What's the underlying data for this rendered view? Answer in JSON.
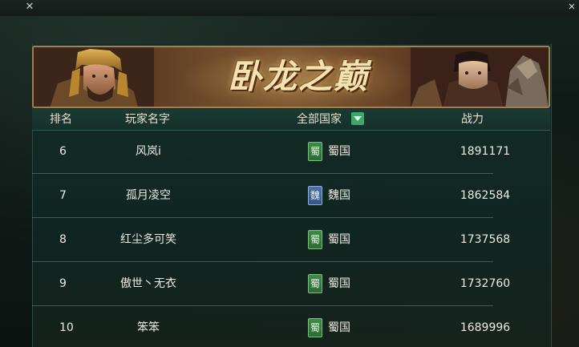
{
  "banner": {
    "title": "卧龙之巅"
  },
  "table": {
    "headers": {
      "rank": "排名",
      "name": "玩家名字",
      "country": "全部国家",
      "power": "战力"
    },
    "rows": [
      {
        "rank": "6",
        "name": "风岚i",
        "badge": "蜀",
        "badge_kind": "shu",
        "country": "蜀国",
        "power": "1891171"
      },
      {
        "rank": "7",
        "name": "孤月凌空",
        "badge": "魏",
        "badge_kind": "wei",
        "country": "魏国",
        "power": "1862584"
      },
      {
        "rank": "8",
        "name": "红尘多可笑",
        "badge": "蜀",
        "badge_kind": "shu",
        "country": "蜀国",
        "power": "1737568"
      },
      {
        "rank": "9",
        "name": "傲世丶无衣",
        "badge": "蜀",
        "badge_kind": "shu",
        "country": "蜀国",
        "power": "1732760"
      },
      {
        "rank": "10",
        "name": "笨笨",
        "badge": "蜀",
        "badge_kind": "shu",
        "country": "蜀国",
        "power": "1689996"
      }
    ]
  },
  "icons": {
    "close_left": "close-icon",
    "close_right": "close-icon",
    "dropdown": "chevron-down-icon"
  },
  "colors": {
    "shu_badge": "#2f7a3b",
    "wei_badge": "#3d5f95",
    "dropdown_accent": "#3da86a",
    "banner_title": "#f4e3b0"
  }
}
